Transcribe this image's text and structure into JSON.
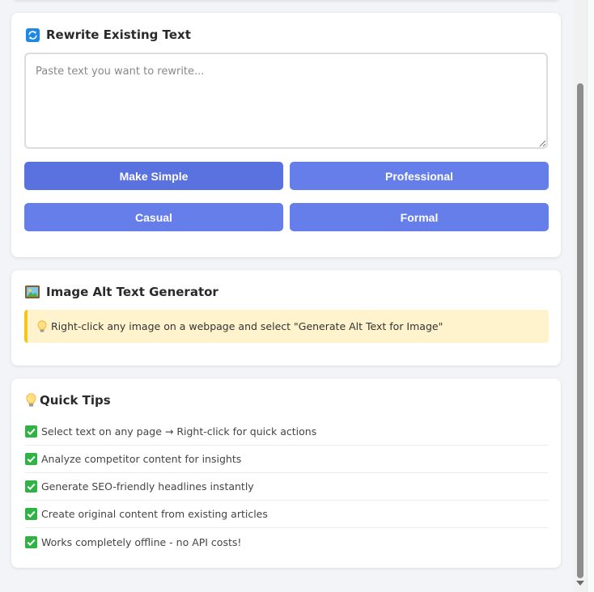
{
  "rewrite": {
    "icon": "refresh-icon",
    "title": "Rewrite Existing Text",
    "placeholder": "Paste text you want to rewrite...",
    "value": "",
    "buttons": {
      "simple": "Make Simple",
      "professional": "Professional",
      "casual": "Casual",
      "formal": "Formal"
    }
  },
  "alt_text": {
    "icon": "framed-picture-icon",
    "title": "Image Alt Text Generator",
    "hint_icon": "lightbulb-icon",
    "hint": "Right-click any image on a webpage and select \"Generate Alt Text for Image\""
  },
  "tips": {
    "icon": "lightbulb-icon",
    "title": "Quick Tips",
    "check_icon": "check-mark-icon",
    "items": [
      "Select text on any page → Right-click for quick actions",
      "Analyze competitor content for insights",
      "Generate SEO-friendly headlines instantly",
      "Create original content from existing articles",
      "Works completely offline - no API costs!"
    ]
  },
  "colors": {
    "accent": "#667eea",
    "accent_hover": "#5a71e0",
    "hint_bg": "#fff3cd",
    "hint_border": "#f5c518",
    "check_green": "#2fb344"
  }
}
